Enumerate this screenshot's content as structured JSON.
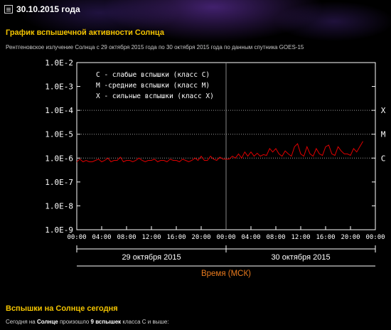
{
  "header": {
    "date": "30.10.2015 года"
  },
  "section1": {
    "title": "График вспышечной активности Солнца",
    "subtitle": "Рентгеновское излучение Солнца с 29 октября 2015 года по 30 октября 2015 года по данным спутника GOES-15"
  },
  "chart_data": {
    "type": "line",
    "y_scale": "log",
    "ylim": [
      1e-09,
      0.01
    ],
    "yticks": [
      "1.0E-2",
      "1.0E-3",
      "1.0E-4",
      "1.0E-5",
      "1.0E-6",
      "1.0E-7",
      "1.0E-8",
      "1.0E-9"
    ],
    "xticks": [
      "00:00",
      "04:00",
      "08:00",
      "12:00",
      "16:00",
      "20:00",
      "00:00",
      "04:00",
      "08:00",
      "12:00",
      "16:00",
      "20:00",
      "00:00"
    ],
    "xlim_hours": [
      0,
      48
    ],
    "dates": [
      "29 октября 2015",
      "30 октября 2015"
    ],
    "xlabel": "Время (МСК)",
    "legend": [
      "C - слабые вспышки (класс C)",
      "M -средние вспышки (класс M)",
      "X - сильные вспышки (класс X)"
    ],
    "legend_position": "top-left",
    "class_levels": [
      {
        "label": "X",
        "value": 0.0001
      },
      {
        "label": "M",
        "value": 1e-05
      },
      {
        "label": "C",
        "value": 1e-06
      }
    ],
    "series_color": "#e00000",
    "series": [
      {
        "x": [
          0,
          0.5,
          1,
          1.5,
          2,
          2.5,
          3,
          3.5,
          4,
          4.5,
          5,
          5.5,
          6,
          6.5,
          7,
          7.5,
          8,
          8.5,
          9,
          9.5,
          10,
          10.5,
          11,
          11.5,
          12,
          12.5,
          13,
          13.5,
          14,
          14.5,
          15,
          15.5,
          16,
          16.5,
          17,
          17.5,
          18,
          18.5,
          19,
          19.5,
          20,
          20.5,
          21,
          21.5,
          22,
          22.5,
          23,
          23.5,
          24,
          24.5,
          25,
          25.5,
          26,
          26.5,
          27,
          27.5,
          28,
          28.5,
          29,
          29.5,
          30,
          30.5,
          31,
          31.5,
          32,
          32.5,
          33,
          33.5,
          34,
          34.5,
          35,
          35.5,
          36,
          36.5,
          37,
          37.5,
          38,
          38.5,
          39,
          39.5,
          40,
          40.5,
          41,
          41.5,
          42,
          42.5,
          43,
          43.5,
          44,
          44.5,
          45,
          45.5,
          46
        ],
        "y": [
          7e-07,
          9e-07,
          7e-07,
          8e-07,
          7e-07,
          7e-07,
          8e-07,
          9e-07,
          7e-07,
          8e-07,
          1e-06,
          7e-07,
          8e-07,
          8e-07,
          1.1e-06,
          7e-07,
          8e-07,
          8e-07,
          7e-07,
          8e-07,
          1e-06,
          8e-07,
          7e-07,
          8e-07,
          8e-07,
          9e-07,
          7e-07,
          8e-07,
          8e-07,
          7e-07,
          9e-07,
          8e-07,
          8e-07,
          7e-07,
          9e-07,
          8e-07,
          7e-07,
          8e-07,
          1e-06,
          8e-07,
          1.2e-06,
          8e-07,
          8e-07,
          1.2e-06,
          9e-07,
          8e-07,
          1.1e-06,
          9e-07,
          9e-07,
          9e-07,
          1.2e-06,
          1e-06,
          1.5e-06,
          1e-06,
          1.8e-06,
          1.2e-06,
          1.8e-06,
          1.2e-06,
          1.6e-06,
          1.2e-06,
          1.4e-06,
          1.3e-06,
          2.5e-06,
          1.8e-06,
          2.5e-06,
          1.5e-06,
          1.2e-06,
          2e-06,
          1.5e-06,
          1.2e-06,
          3e-06,
          4e-06,
          1.5e-06,
          1.2e-06,
          3e-06,
          1.5e-06,
          1.2e-06,
          2.5e-06,
          1.5e-06,
          1.3e-06,
          3e-06,
          3.5e-06,
          1.5e-06,
          1.3e-06,
          3e-06,
          2e-06,
          1.5e-06,
          1.5e-06,
          1.3e-06,
          2.5e-06,
          1.8e-06,
          3e-06,
          5e-06
        ]
      }
    ]
  },
  "section2": {
    "title": "Вспышки на Солнце сегодня",
    "text_before": "Сегодня на ",
    "text_bold1": "Солнце",
    "text_mid": " произошло ",
    "text_bold2": "9 вспышек",
    "text_after": " класса С и выше:"
  }
}
